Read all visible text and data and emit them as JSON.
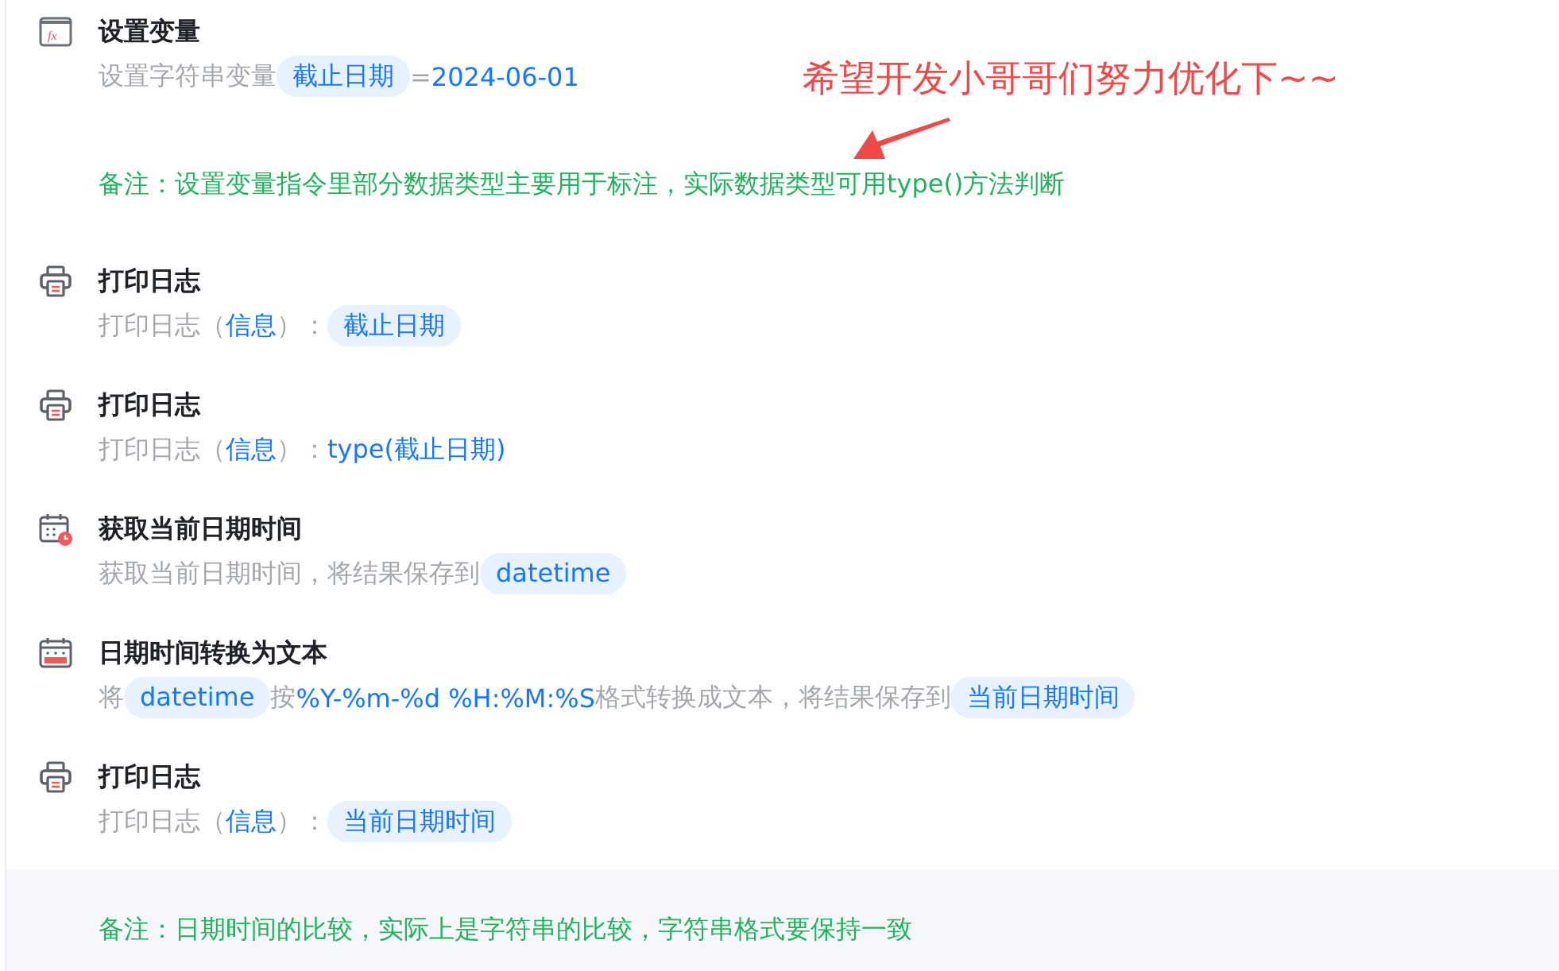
{
  "steps": [
    {
      "kind": "set-variable",
      "icon_label": "fx",
      "title": "设置变量",
      "parts": [
        {
          "kind": "plain",
          "text": "设置字符串变量"
        },
        {
          "kind": "var",
          "text": "截止日期"
        },
        {
          "kind": "plain",
          "text": "="
        },
        {
          "kind": "value",
          "text": "2024-06-01"
        }
      ]
    },
    {
      "kind": "note",
      "shaded": false,
      "text": "备注：设置变量指令里部分数据类型主要用于标注，实际数据类型可用type()方法判断"
    },
    {
      "kind": "print-log",
      "title": "打印日志",
      "parts": [
        {
          "kind": "plain",
          "text": "打印日志（"
        },
        {
          "kind": "value",
          "text": "信息"
        },
        {
          "kind": "plain",
          "text": "）："
        },
        {
          "kind": "var",
          "text": "截止日期"
        }
      ]
    },
    {
      "kind": "print-log",
      "title": "打印日志",
      "parts": [
        {
          "kind": "plain",
          "text": "打印日志（"
        },
        {
          "kind": "value",
          "text": "信息"
        },
        {
          "kind": "plain",
          "text": "）："
        },
        {
          "kind": "value",
          "text": "type(截止日期)"
        }
      ]
    },
    {
      "kind": "get-datetime",
      "title": "获取当前日期时间",
      "parts": [
        {
          "kind": "plain",
          "text": "获取当前日期时间，将结果保存到"
        },
        {
          "kind": "var",
          "text": "datetime"
        }
      ]
    },
    {
      "kind": "format-datetime",
      "title": "日期时间转换为文本",
      "parts": [
        {
          "kind": "plain",
          "text": "将"
        },
        {
          "kind": "var",
          "text": "datetime"
        },
        {
          "kind": "plain",
          "text": "按"
        },
        {
          "kind": "value",
          "text": "%Y-%m-%d %H:%M:%S"
        },
        {
          "kind": "plain",
          "text": "格式转换成文本，将结果保存到"
        },
        {
          "kind": "var",
          "text": "当前日期时间"
        }
      ]
    },
    {
      "kind": "print-log",
      "title": "打印日志",
      "parts": [
        {
          "kind": "plain",
          "text": "打印日志（"
        },
        {
          "kind": "value",
          "text": "信息"
        },
        {
          "kind": "plain",
          "text": "）："
        },
        {
          "kind": "var",
          "text": "当前日期时间"
        }
      ]
    },
    {
      "kind": "note",
      "shaded": true,
      "text": "备注：日期时间的比较，实际上是字符串的比较，字符串格式要保持一致"
    }
  ],
  "annotation": {
    "text": "希望开发小哥哥们努力优化下~~"
  }
}
